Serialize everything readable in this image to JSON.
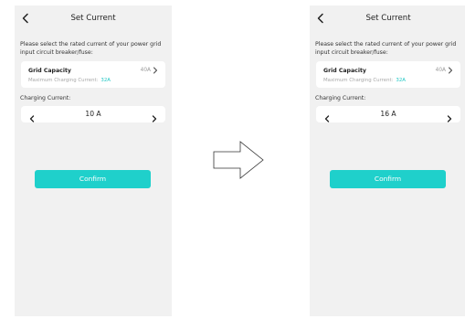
{
  "screens": [
    {
      "title": "Set Current",
      "instruction": "Please select the rated current of your power grid input circuit breaker/fuse:",
      "grid_capacity": {
        "label": "Grid Capacity",
        "value": "40A",
        "sub_label": "Maximum Charging Current:",
        "sub_value": "32A"
      },
      "charging_label": "Charging Current:",
      "charging_value": "10 A",
      "confirm_label": "Confirm"
    },
    {
      "title": "Set Current",
      "instruction": "Please select the rated current of your power grid input circuit breaker/fuse:",
      "grid_capacity": {
        "label": "Grid Capacity",
        "value": "40A",
        "sub_label": "Maximum Charging Current:",
        "sub_value": "32A"
      },
      "charging_label": "Charging Current:",
      "charging_value": "16 A",
      "confirm_label": "Confirm"
    }
  ],
  "icons": {
    "back": "chevron-left-icon",
    "grid_more": "chevron-right-icon",
    "decrease": "chevron-left-icon",
    "increase": "chevron-right-icon",
    "transition": "right-arrow-icon"
  },
  "colors": {
    "accent": "#1ec6c3",
    "button": "#1fd0cb",
    "screen_bg": "#f1f1f1",
    "card_bg": "#ffffff"
  }
}
